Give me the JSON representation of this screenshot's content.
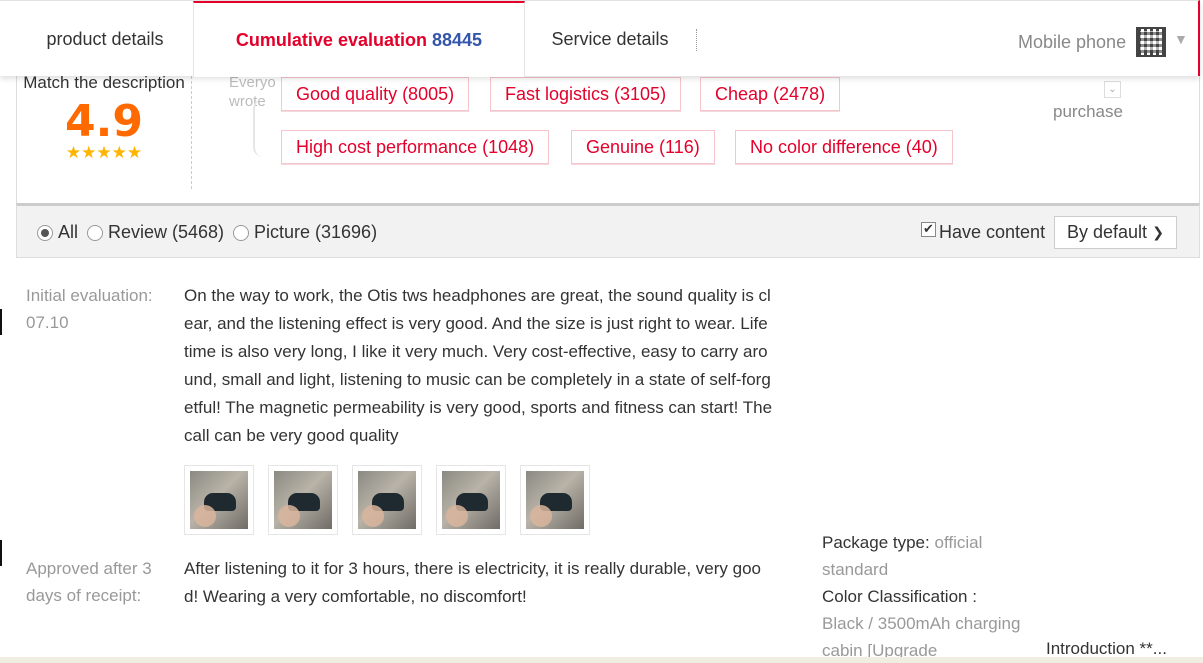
{
  "tabs": {
    "product_details": "product details",
    "cumulative_label": "Cumulative evaluation",
    "cumulative_count": "88445",
    "service_details": "Service details",
    "mobile_phone": "Mobile phone"
  },
  "summary": {
    "match_label": "Match the description",
    "score": "4.9",
    "stars": "★★★★★",
    "ghost_text_1": "Everyo",
    "ghost_text_2": "wrote",
    "purchase": "purchase",
    "tags": [
      "Good quality (8005)",
      "Fast logistics (3105)",
      "Cheap (2478)",
      "High cost performance (1048)",
      "Genuine (116)",
      "No color difference (40)"
    ]
  },
  "filter": {
    "all": "All",
    "review": "Review (5468)",
    "picture": "Picture (31696)",
    "have_content": "Have content",
    "sort": "By default"
  },
  "reviews": [
    {
      "label": "Initial evaluation:",
      "date": "07.10",
      "text": "On the way to work, the Otis tws headphones are great, the sound quality is clear, and the listening effect is very good. And the size is just right to wear. Life time is also very long, I like it very much. Very cost-effective, easy to carry around, small and light, listening to music can be completely in a state of self-forgetful! The magnetic permeability is very good, sports and fitness can start! The call can be very good quality"
    },
    {
      "label": "Approved after 3 days of receipt:",
      "text": "After listening to it for 3 hours, there is electricity, it is really durable, very good! Wearing a very comfortable, no discomfort!"
    }
  ],
  "sku": {
    "package_label": "Package type:",
    "package_value": "official standard",
    "color_label": "Color Classification :",
    "color_value": "Black / 3500mAh charging cabin [Upgrade"
  },
  "intro": "Introduction **..."
}
